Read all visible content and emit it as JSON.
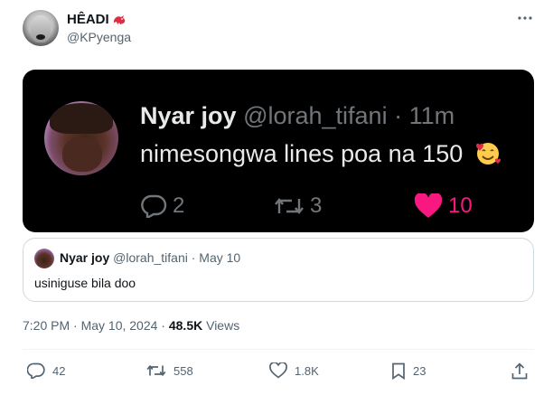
{
  "author": {
    "name": "HÊADI",
    "handle": "@KPyenga",
    "name_emoji": "red-dragon-emoji"
  },
  "header": {
    "more_icon": "more-horizontal-icon"
  },
  "screenshot": {
    "name": "Nyar joy",
    "handle": "@lorah_tifani",
    "time": "· 11m",
    "text": "nimesongwa lines poa na 150",
    "emoji": "smiling-face-with-hearts-emoji",
    "replies": "2",
    "reposts": "3",
    "likes": "10"
  },
  "quote": {
    "name": "Nyar joy",
    "handle": "@lorah_tifani",
    "date": "· May 10",
    "text": "usiniguse bila doo"
  },
  "meta": {
    "time": "7:20 PM · May 10, 2024 · ",
    "views_count": "48.5K",
    "views_label": " Views"
  },
  "actions": {
    "replies": "42",
    "reposts": "558",
    "likes": "1.8K",
    "bookmarks": "23"
  },
  "colors": {
    "like_pink": "#f91880",
    "secondary_text": "#536471",
    "border": "#cfd9de"
  }
}
